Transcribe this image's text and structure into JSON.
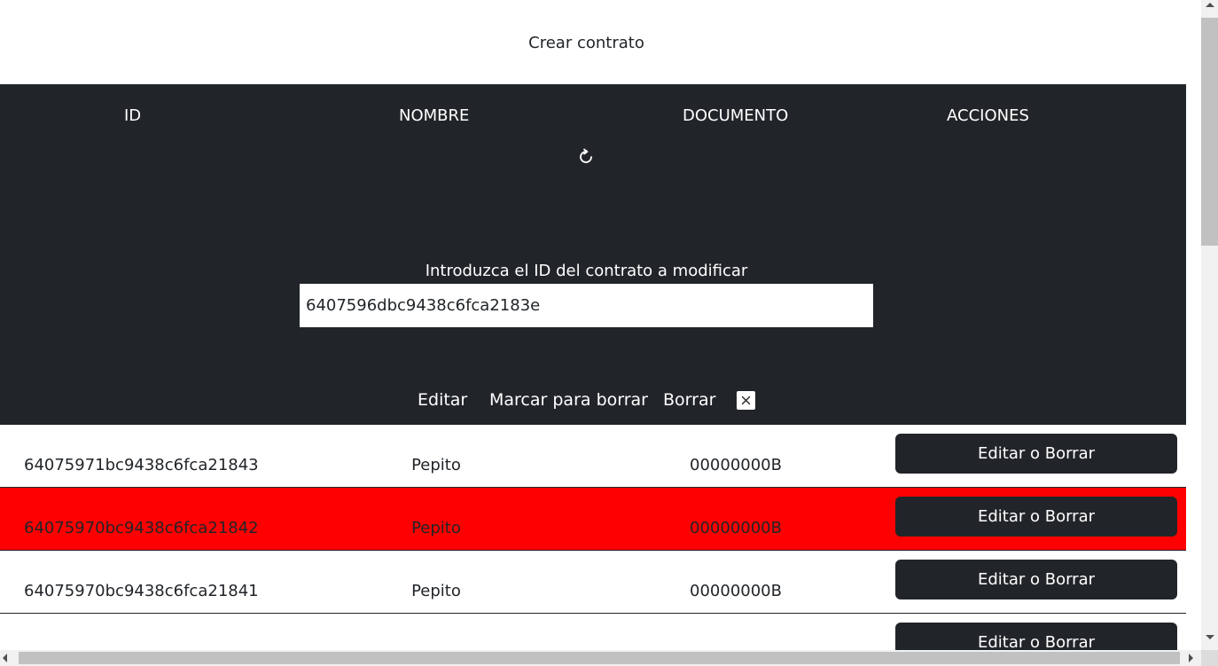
{
  "top": {
    "create_label": "Crear contrato"
  },
  "table": {
    "headers": [
      "ID",
      "NOMBRE",
      "DOCUMENTO",
      "ACCIONES"
    ],
    "rows": [
      {
        "id": "64075971bc9438c6fca21843",
        "nombre": "Pepito",
        "documento": "00000000B",
        "action": "Editar o Borrar",
        "marked": false
      },
      {
        "id": "64075970bc9438c6fca21842",
        "nombre": "Pepito",
        "documento": "00000000B",
        "action": "Editar o Borrar",
        "marked": true
      },
      {
        "id": "64075970bc9438c6fca21841",
        "nombre": "Pepito",
        "documento": "00000000B",
        "action": "Editar o Borrar",
        "marked": false
      },
      {
        "id": "",
        "nombre": "",
        "documento": "",
        "action": "Editar o Borrar",
        "marked": false
      }
    ]
  },
  "editor": {
    "prompt": "Introduzca el ID del contrato a modificar",
    "input_value": "6407596dbc9438c6fca2183e",
    "actions": [
      "Editar",
      "Marcar para borrar",
      "Borrar"
    ],
    "close_symbol": "×"
  },
  "icons": {
    "refresh": "refresh-icon",
    "close": "close-icon"
  },
  "colors": {
    "dark": "#212529",
    "marked_row": "#ff0000"
  }
}
